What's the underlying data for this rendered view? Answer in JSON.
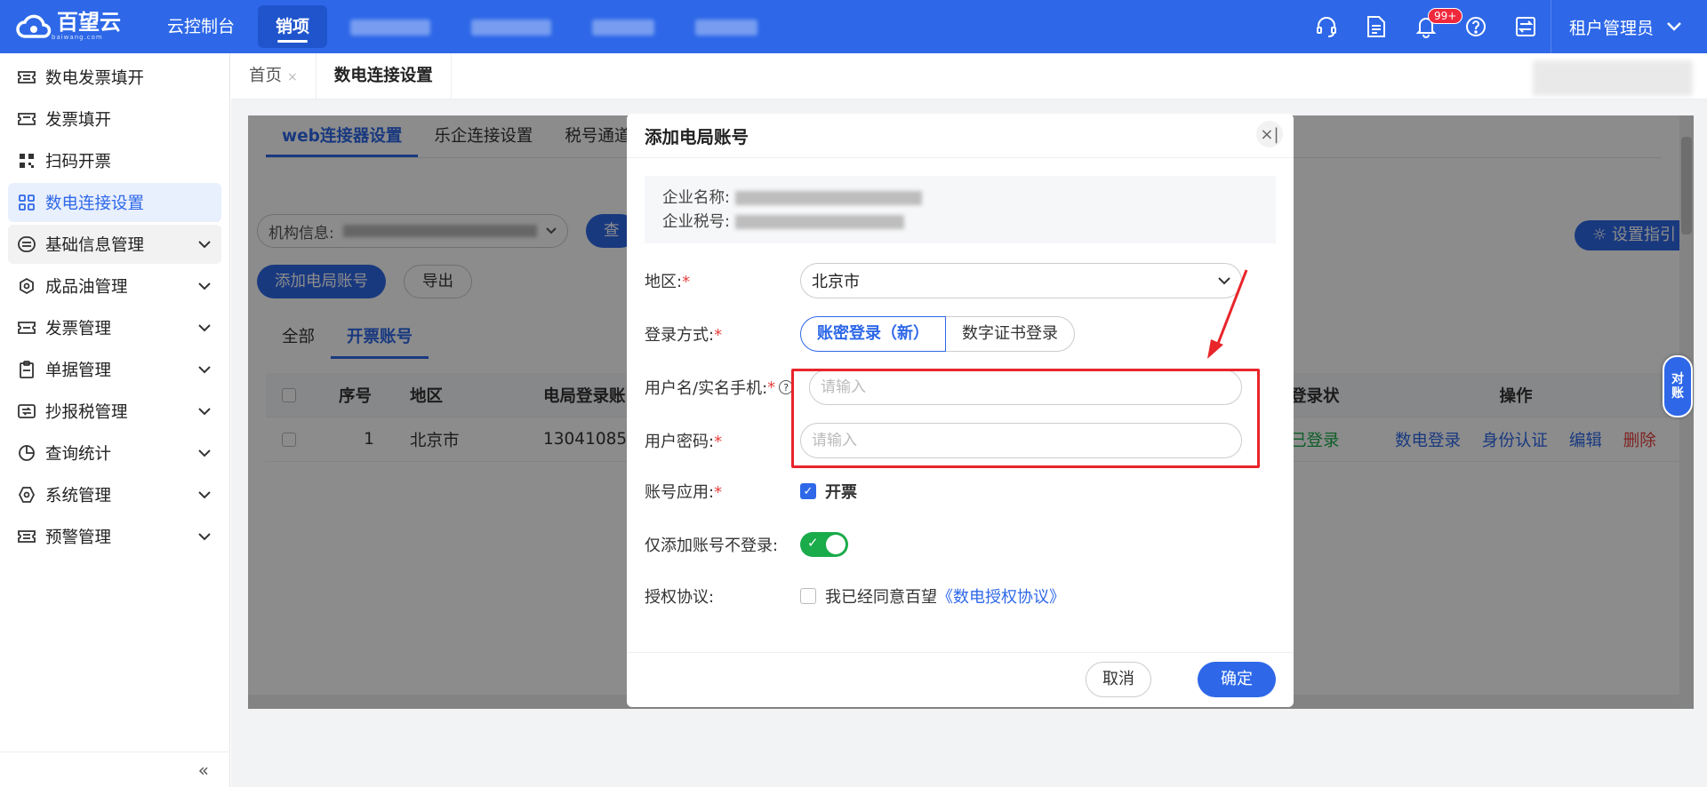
{
  "brand": {
    "logo_text": "百望云",
    "logo_sub": "baiwang.com"
  },
  "topnav": {
    "items": [
      {
        "label": "云控制台"
      },
      {
        "label": "销项"
      }
    ],
    "badge": "99+",
    "user": "租户管理员"
  },
  "sidebar": {
    "items": [
      {
        "label": "数电发票填开"
      },
      {
        "label": "发票填开"
      },
      {
        "label": "扫码开票"
      },
      {
        "label": "数电连接设置"
      },
      {
        "label": "基础信息管理"
      },
      {
        "label": "成品油管理"
      },
      {
        "label": "发票管理"
      },
      {
        "label": "单据管理"
      },
      {
        "label": "抄报税管理"
      },
      {
        "label": "查询统计"
      },
      {
        "label": "系统管理"
      },
      {
        "label": "预警管理"
      }
    ],
    "collapse": "«"
  },
  "page_tabs": [
    {
      "label": "首页"
    },
    {
      "label": "数电连接设置"
    }
  ],
  "panel": {
    "tabs": [
      {
        "label": "web连接器设置"
      },
      {
        "label": "乐企连接设置"
      },
      {
        "label": "税号通道设"
      }
    ],
    "filter_label": "机构信息:",
    "search_label": "查",
    "add_button": "添加电局账号",
    "export_button": "导出",
    "guide_button": "设置指引",
    "sub_tabs": [
      {
        "label": "全部"
      },
      {
        "label": "开票账号"
      }
    ],
    "table": {
      "headers": {
        "index": "序号",
        "region": "地区",
        "account": "电局登录账",
        "login_status": "登录状",
        "ops": "操作"
      },
      "row": {
        "index": "1",
        "region": "北京市",
        "account": "13041085",
        "login_status": "已登录"
      },
      "ops": {
        "login": "数电登录",
        "verify": "身份认证",
        "edit": "编辑",
        "delete": "删除"
      }
    }
  },
  "float_chip": {
    "line1": "对",
    "line2": "账"
  },
  "modal": {
    "title": "添加电局账号",
    "close": "×|",
    "company": {
      "name_label": "企业名称:",
      "tax_label": "企业税号:"
    },
    "region": {
      "label": "地区:",
      "value": "北京市"
    },
    "login_method": {
      "label": "登录方式:",
      "option_on": "账密登录（新）",
      "option_off": "数字证书登录"
    },
    "username": {
      "label": "用户名/实名手机:",
      "placeholder": "请输入"
    },
    "password": {
      "label": "用户密码:",
      "placeholder": "请输入"
    },
    "account_usage": {
      "label": "账号应用:",
      "value": "开票"
    },
    "add_only": {
      "label": "仅添加账号不登录:",
      "enabled": true
    },
    "agreement": {
      "label": "授权协议:",
      "text": "我已经同意百望",
      "link": "《数电授权协议》"
    },
    "cancel": "取消",
    "confirm": "确定"
  },
  "colors": {
    "primary": "#2e68e8",
    "danger": "#e84040",
    "success": "#1aab4a",
    "annotation": "#e8252a"
  }
}
